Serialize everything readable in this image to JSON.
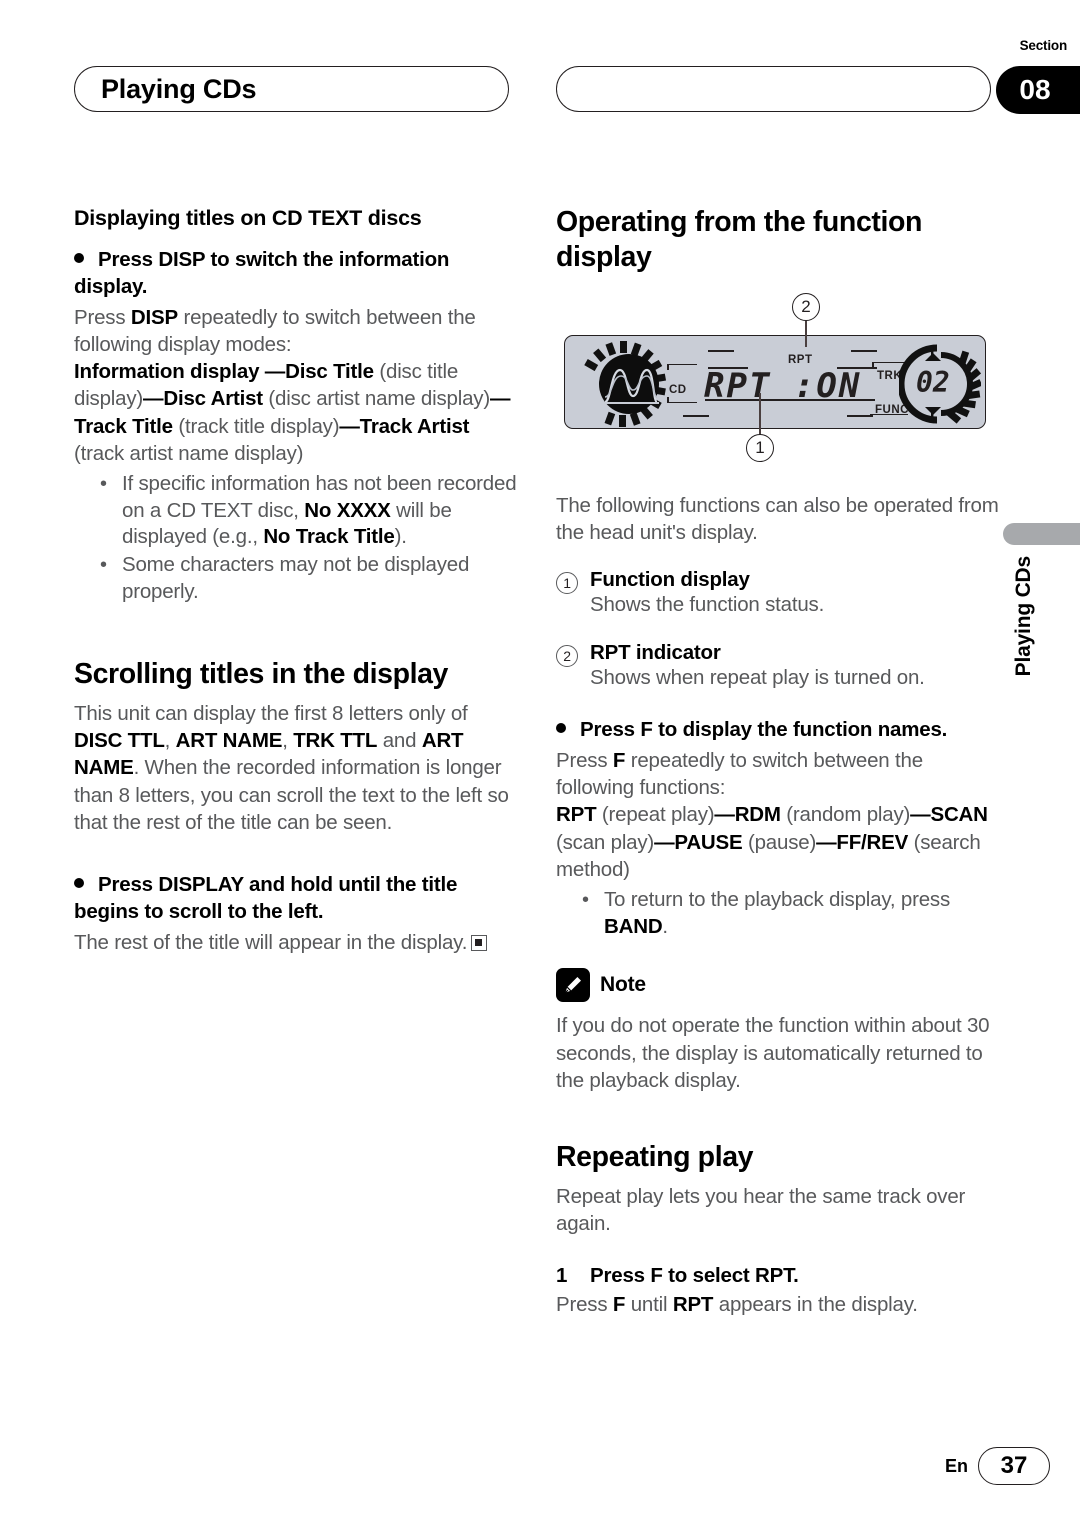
{
  "header": {
    "left_title": "Playing CDs",
    "right_title": "",
    "section_label": "Section",
    "section_number": "08"
  },
  "side_tab": {
    "text": "Playing CDs"
  },
  "footer": {
    "language": "En",
    "page_number": "37"
  },
  "left_column": {
    "heading_cdtext": "Displaying titles on CD TEXT discs",
    "lead_disp": "Press DISP to switch the information display.",
    "para_disp_1_a": "Press ",
    "para_disp_1_b": "DISP",
    "para_disp_1_c": " repeatedly to switch between the following display modes:",
    "modes_line": "Information display —Disc Title (disc title display)—Disc Artist (disc artist name display)—Track Title (track title display)—Track Artist (track artist name display)",
    "mode_info_display": "Information display ",
    "mode_dash1": "—",
    "mode_disc_title": "Disc Title",
    "mode_disc_title_desc": " (disc title display)",
    "mode_disc_artist": "Disc Artist",
    "mode_disc_artist_desc": " (disc artist name display)",
    "mode_track_title": "Track Title",
    "mode_track_title_desc": " (track title display)",
    "mode_track_artist": "Track Artist",
    "mode_track_artist_desc": " (track artist name display)",
    "bullets": [
      {
        "pre": "If specific information has not been recorded on a CD TEXT disc, ",
        "bold": "No XXXX",
        "mid": " will be displayed (e.g., ",
        "bold2": "No Track Title",
        "post": ")."
      },
      {
        "pre": "Some characters may not be displayed properly.",
        "bold": "",
        "mid": "",
        "bold2": "",
        "post": ""
      }
    ],
    "heading_scrolling": "Scrolling titles in the display",
    "scroll_p1_a": "This unit can display the first 8 letters only of ",
    "scroll_p1_b1": "DISC TTL",
    "scroll_p1_sep1": ", ",
    "scroll_p1_b2": "ART NAME",
    "scroll_p1_sep2": ", ",
    "scroll_p1_b3": "TRK TTL",
    "scroll_p1_c": " and ",
    "scroll_p1_b4": "ART NAME",
    "scroll_p1_d": ". When the recorded information is longer than 8 letters, you can scroll the text to the left so that the rest of the title can be seen.",
    "lead_display_hold": "Press DISPLAY and hold until the title begins to scroll to the left.",
    "rest_of_title": "The rest of the title will appear in the display."
  },
  "right_column": {
    "heading_operating": "Operating from the function display",
    "intro": "The following functions can also be operated from the head unit's display.",
    "callouts": [
      {
        "num": "1",
        "title": "Function display",
        "desc": "Shows the function status."
      },
      {
        "num": "2",
        "title": "RPT indicator",
        "desc": "Shows when repeat play is turned on."
      }
    ],
    "lead_press_f": "Press F to display the function names.",
    "press_f_a": "Press ",
    "press_f_b": "F",
    "press_f_c": " repeatedly to switch between the following functions:",
    "functions": {
      "f1": "RPT",
      "f1d": " (repeat play)",
      "sep1": "—",
      "f2": "RDM",
      "f2d": " (random play)",
      "sep2": "—",
      "f3": "SCAN",
      "f3d": " (scan play)",
      "sep3": "—",
      "f4": "PAUSE",
      "f4d": " (pause)",
      "sep4": "—",
      "f5": "FF/REV",
      "f5d": " (search method)"
    },
    "bullet_band_pre": "To return to the playback display, press ",
    "bullet_band_bold": "BAND",
    "bullet_band_post": ".",
    "note_label": "Note",
    "note_text": "If you do not operate the function within about 30 seconds, the display is automatically returned to the playback display.",
    "heading_repeating": "Repeating play",
    "repeat_intro": "Repeat play lets you hear the same track over again.",
    "step1_num": "1",
    "step1_title": "Press F to select RPT.",
    "step1_a": "Press ",
    "step1_b": "F",
    "step1_c": " until ",
    "step1_d": "RPT",
    "step1_e": " appears in the display."
  },
  "illustration": {
    "callout_1": "1",
    "callout_2": "2",
    "lcd_main_text": "RPT :ON",
    "label_rpt": "RPT",
    "label_trk": "TRK",
    "label_func": "FUNC",
    "label_cd": "CD",
    "track_number": "02",
    "colors": {
      "panel": "#c9cdd6",
      "ink": "#231f20"
    }
  }
}
